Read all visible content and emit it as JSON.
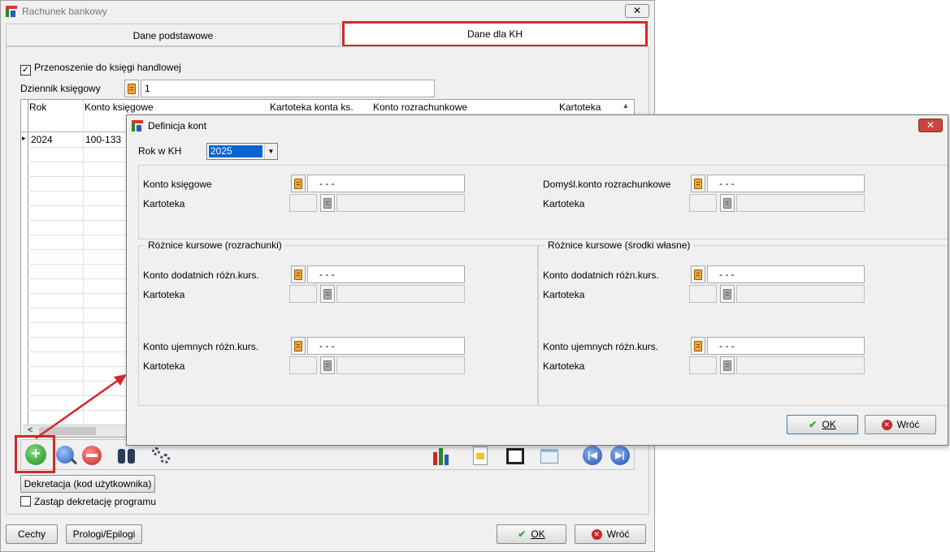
{
  "main_window": {
    "title": "Rachunek bankowy",
    "close_glyph": "✕",
    "tabs": [
      "Dane podstawowe",
      "Dane dla KH"
    ],
    "transfer_checkbox_label": "Przenoszenie do księgi handlowej",
    "journal_label": "Dziennik księgowy",
    "journal_value": "1",
    "grid": {
      "columns": [
        "Rok",
        "Konto księgowe",
        "Kartoteka konta ks.",
        "Konto rozrachunkowe",
        "Kartoteka"
      ],
      "rows": [
        {
          "rok": "2024",
          "konto": "100-133"
        }
      ],
      "row_marker": "▸",
      "scroll_left": "<",
      "scroll_up": "▲"
    },
    "decree_button": "Dekretacja (kod użytkownika)",
    "replace_checkbox_label": "Zastąp dekretację programu",
    "footer": {
      "cechy": "Cechy",
      "prologi": "Prologi/Epilogi",
      "ok": "OK",
      "wroc": "Wróć"
    }
  },
  "dialog": {
    "title": "Definicja kont",
    "close_glyph": "✕",
    "year_label": "Rok w KH",
    "year_value": "2025",
    "konto_ksiegowe_label": "Konto księgowe",
    "domysl_label": "Domyśl.konto rozrachunkowe",
    "kartoteka_label": "Kartoteka",
    "account_placeholder": "-  -  -",
    "group_left_title": "Różnice kursowe (rozrachunki)",
    "group_right_title": "Różnice kursowe (środki własne)",
    "dodatnie_label": "Konto dodatnich różn.kurs.",
    "ujemne_label": "Konto ujemnych różn.kurs.",
    "ok": "OK",
    "wroc": "Wróć"
  },
  "colors": {
    "highlight_red": "#d12a2a",
    "selection_blue": "#0a64d2",
    "ok_green": "#3aa53a",
    "cancel_red": "#c62828"
  }
}
